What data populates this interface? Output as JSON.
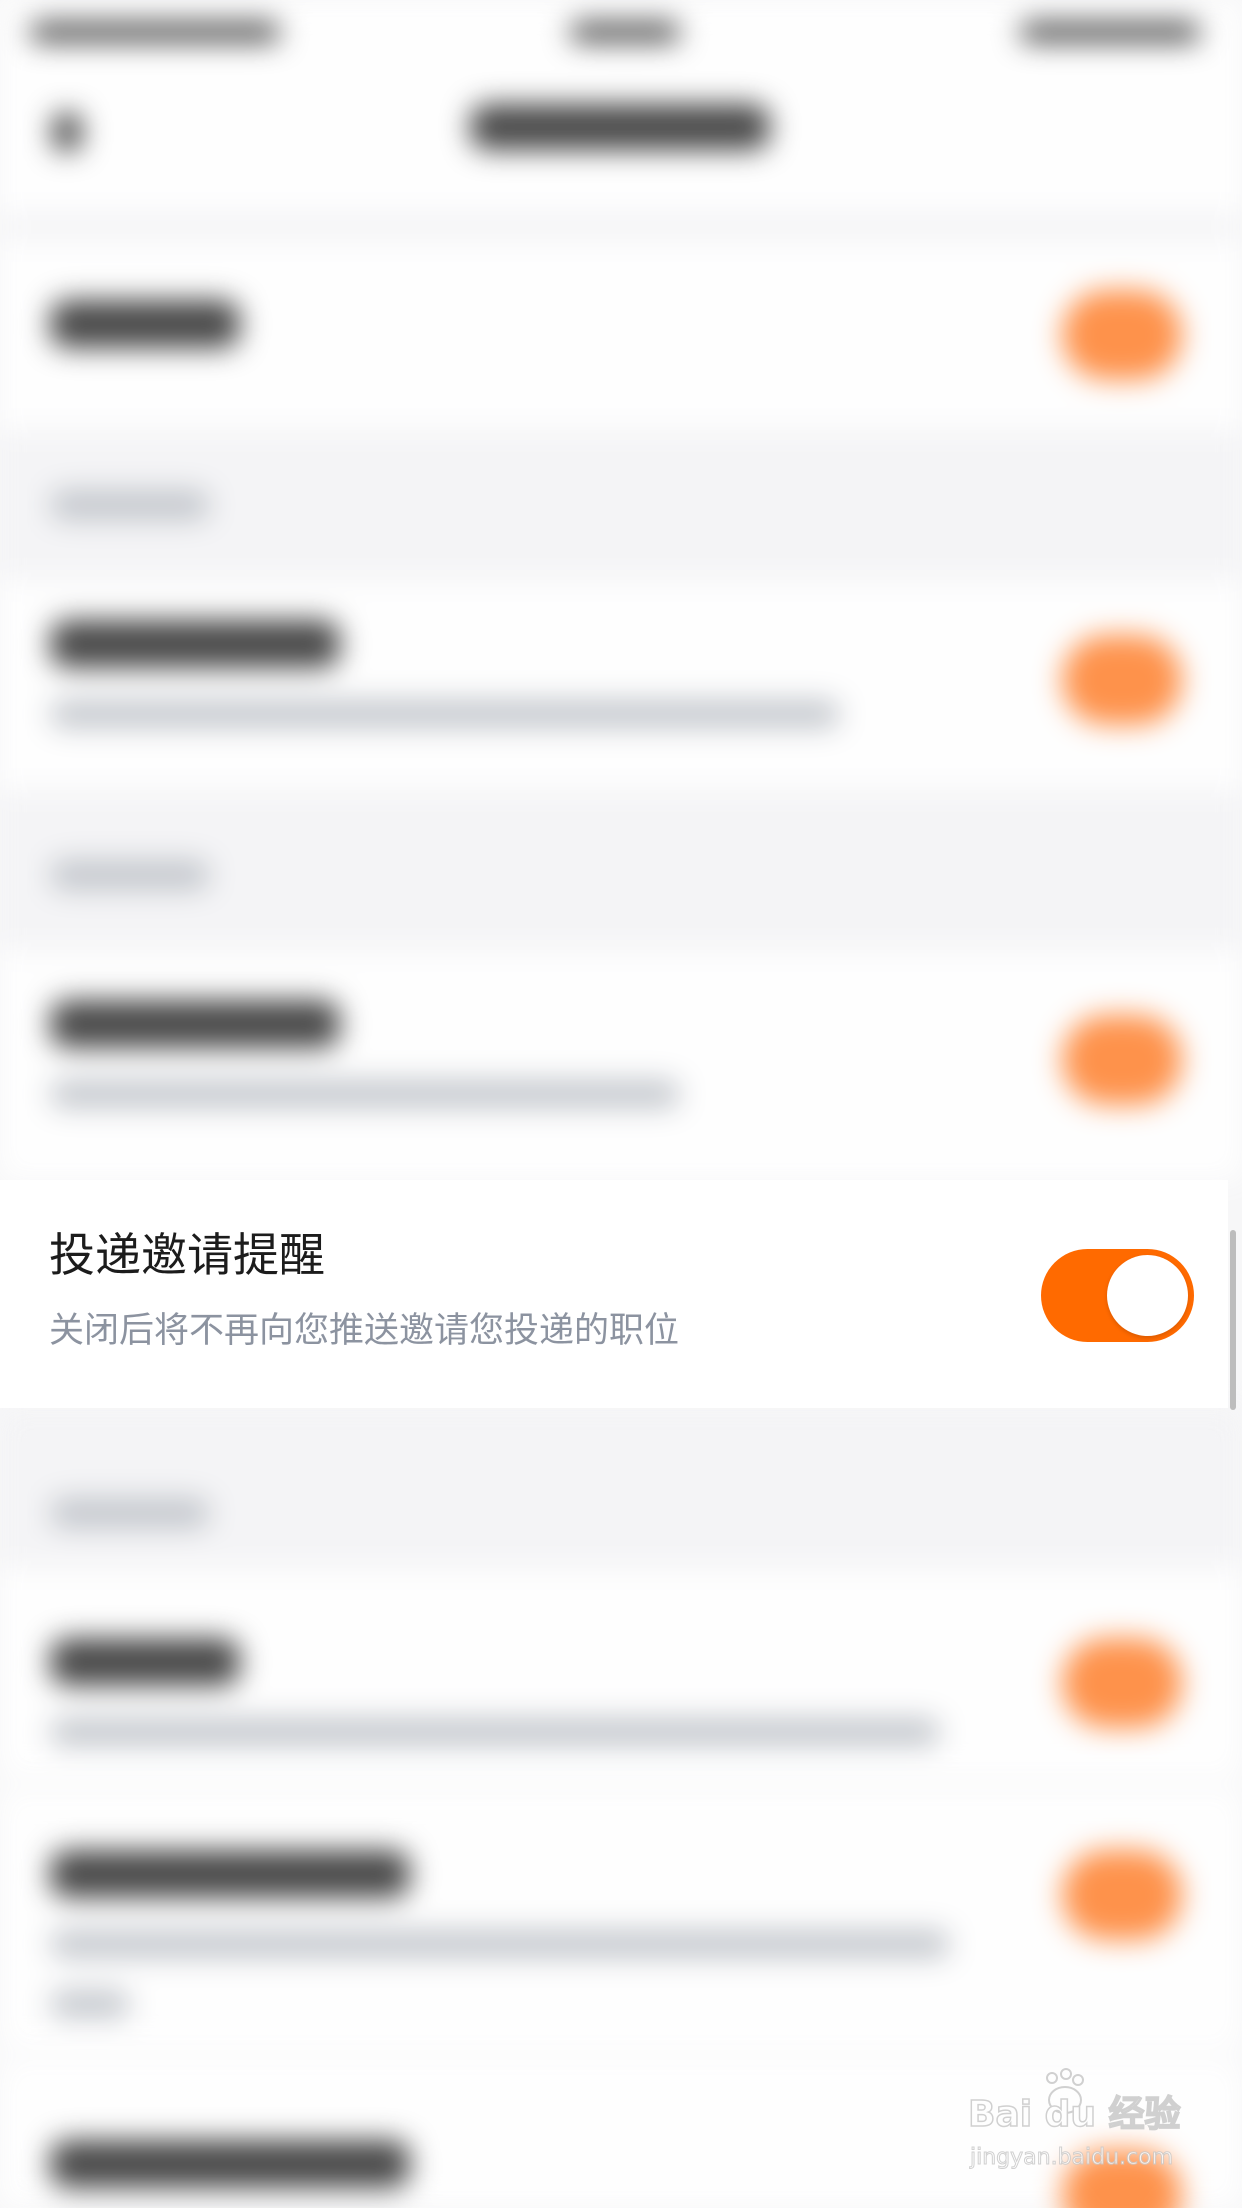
{
  "setting": {
    "title": "投递邀请提醒",
    "description": "关闭后将不再向您推送邀请您投递的职位",
    "enabled": true
  },
  "colors": {
    "accent": "#ff6a00",
    "title_text": "#1c1c1c",
    "description_text": "#8c93a0",
    "background": "#f7f7f8"
  },
  "watermark": {
    "brand": "Bai du 经验",
    "url": "jingyan.baidu.com"
  },
  "icons": {
    "back": "back-arrow-icon",
    "watermark": "baidu-paw-icon"
  }
}
